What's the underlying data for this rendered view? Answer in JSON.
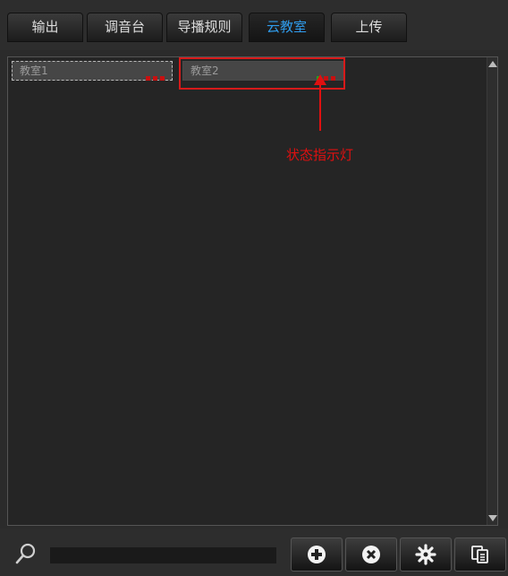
{
  "tabs": [
    {
      "label": "输出"
    },
    {
      "label": "调音台"
    },
    {
      "label": "导播规则"
    },
    {
      "label": "云教室",
      "active": true
    },
    {
      "label": "上传"
    }
  ],
  "rooms": [
    {
      "label": "教室1",
      "status_colors": [
        "#c81010",
        "#c81010",
        "#c81010"
      ]
    },
    {
      "label": "教室2",
      "status_colors": [
        "#1fa51f",
        "#c81010",
        "#c81010"
      ]
    }
  ],
  "annotation": {
    "text": "状态指示灯"
  },
  "search": {
    "value": "",
    "placeholder": ""
  },
  "toolbar": {
    "buttons": [
      "add-icon",
      "remove-icon",
      "settings-icon",
      "copy-icon"
    ]
  }
}
